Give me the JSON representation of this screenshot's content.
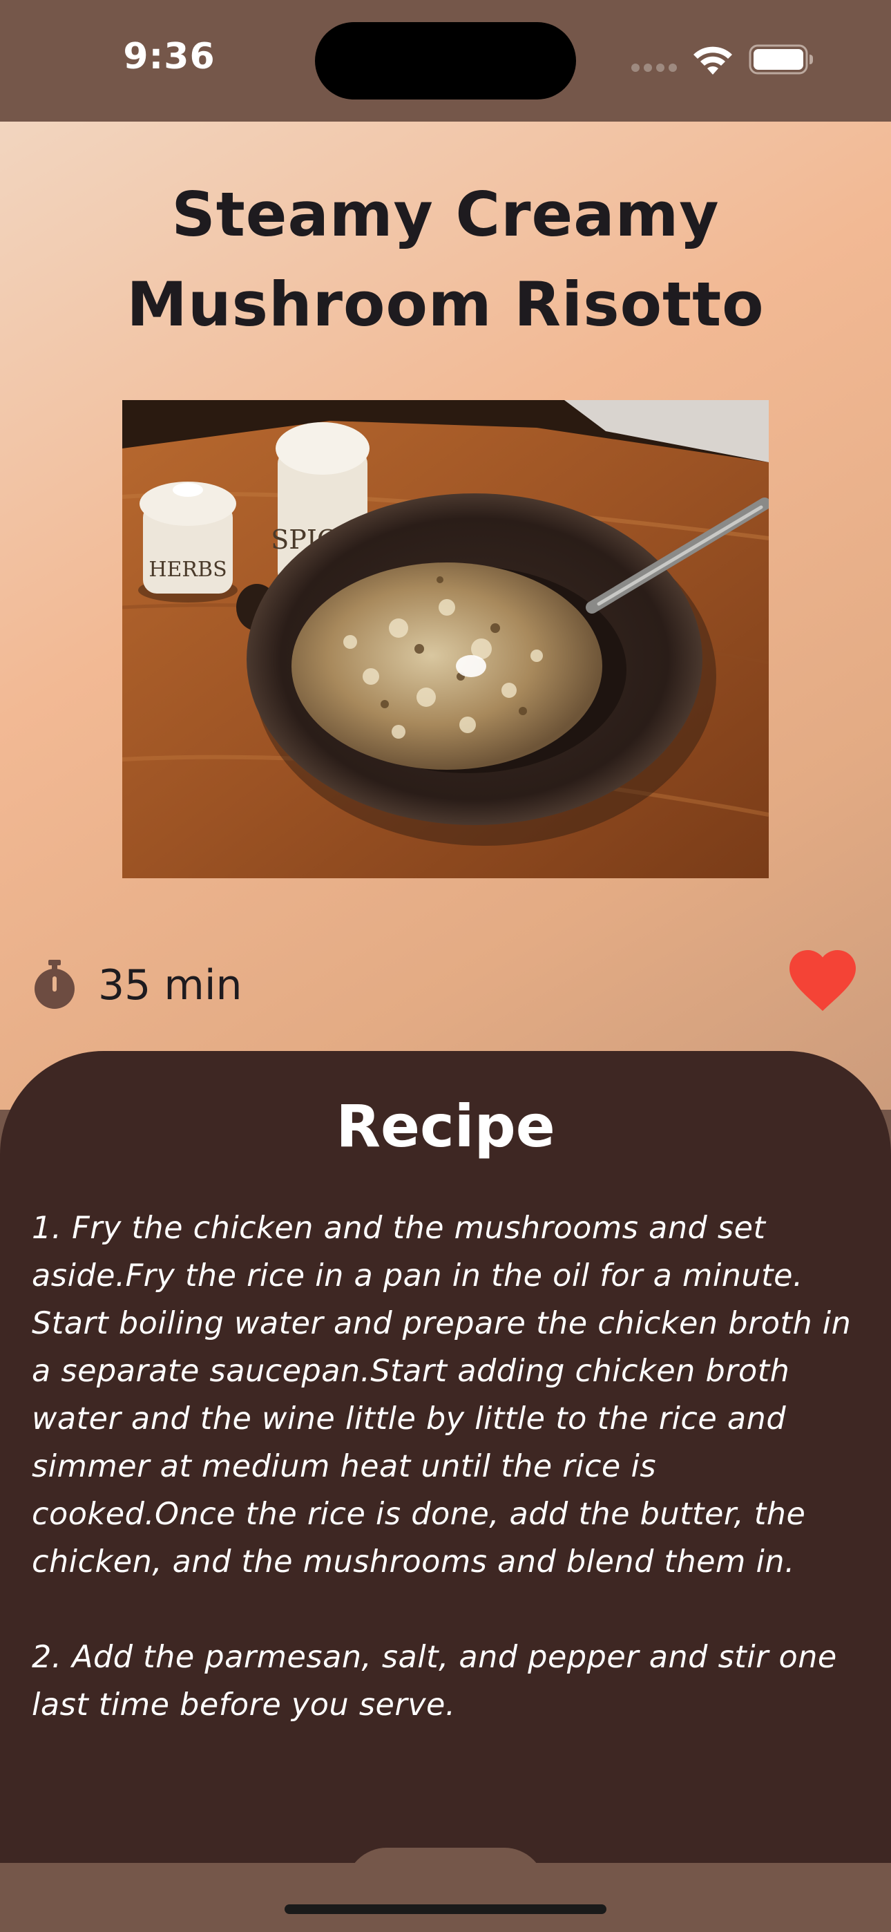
{
  "status_bar": {
    "time": "9:36"
  },
  "recipe": {
    "title": "Steamy Creamy Mushroom Risotto",
    "duration": "35 min",
    "is_favorite": true
  },
  "sheet": {
    "heading": "Recipe",
    "instructions": "1. Fry the chicken and the mushrooms and set aside.Fry the rice in a pan in the oil for a minute. Start boiling water and prepare the chicken broth in a separate saucepan.Start adding chicken broth water and the wine little by little to the rice and simmer at medium heat until the rice is cooked.Once the rice is done, add the butter, the chicken, and the mushrooms and blend them in.\n\n2. Add the parmesan, salt, and pepper and stir one last time before you serve."
  },
  "colors": {
    "header_brown": "#75574a",
    "sheet_dark_brown": "#3e2723",
    "heart_red": "#f44336",
    "gradient_light": "#f2d5bf",
    "gradient_peach": "#f2b994"
  },
  "icons": {
    "signal": "cellular-signal-icon",
    "wifi": "wifi-icon",
    "battery": "battery-icon",
    "timer": "stopwatch-icon",
    "favorite": "heart-icon"
  }
}
